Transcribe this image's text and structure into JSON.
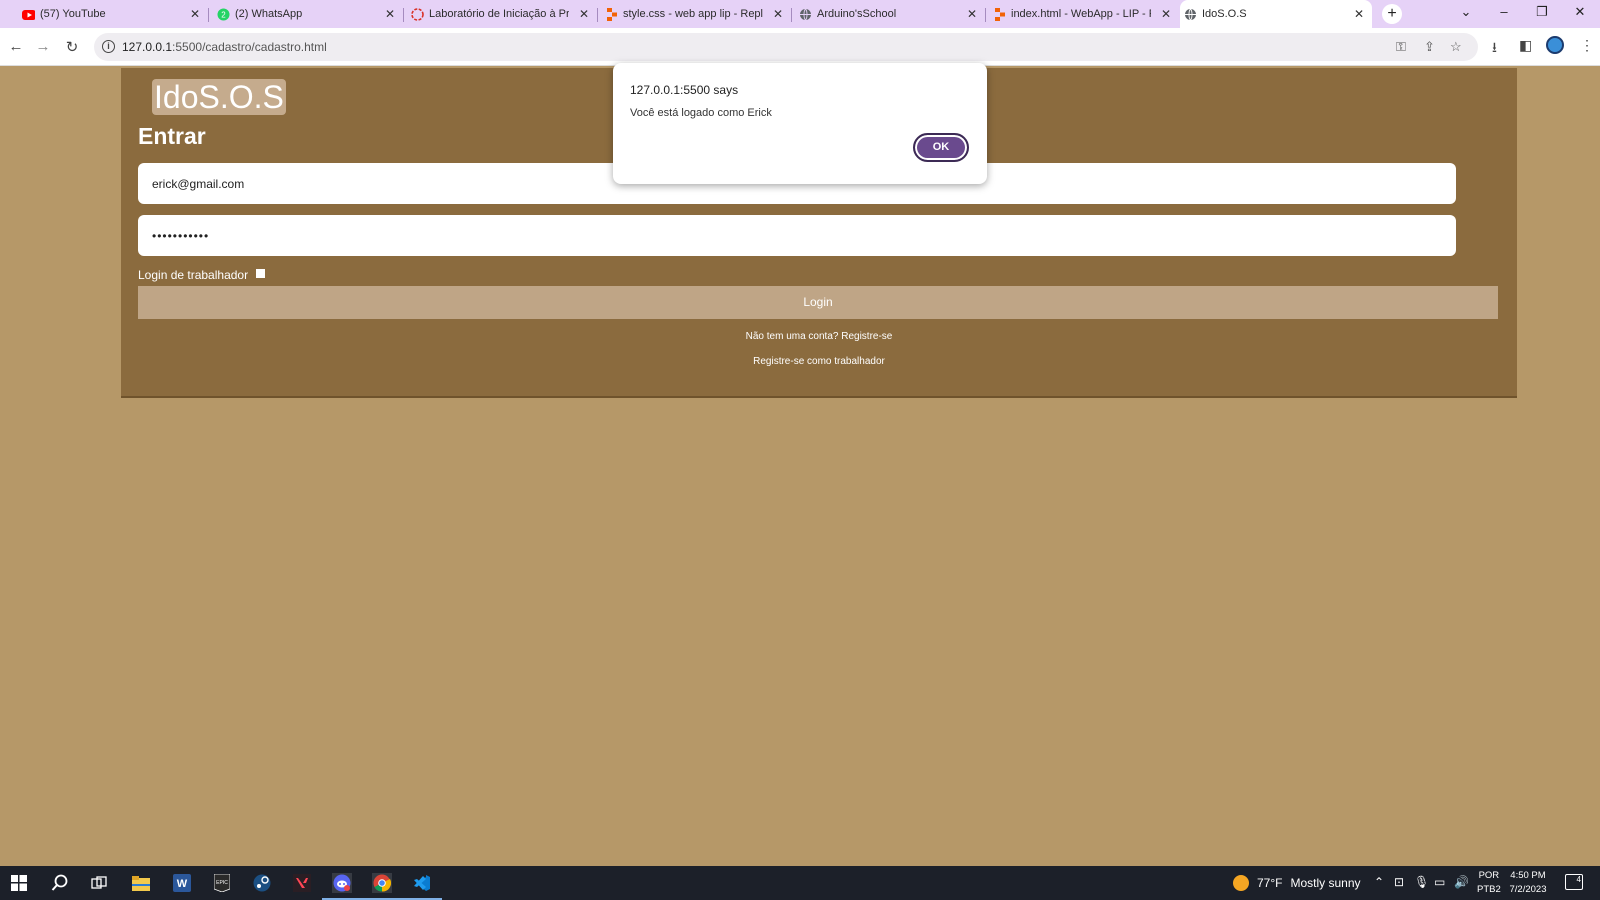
{
  "browser": {
    "tabs": [
      {
        "title": "(57) YouTube",
        "icon": "youtube-icon",
        "icon_color": "#ff0000"
      },
      {
        "title": "(2) WhatsApp",
        "icon": "whatsapp-icon",
        "icon_color": "#25d366"
      },
      {
        "title": "Laboratório de Iniciação à Prog",
        "icon": "lab-icon",
        "icon_color": "#d93025"
      },
      {
        "title": "style.css - web app lip - Replit",
        "icon": "replit-icon",
        "icon_color": "#f26207"
      },
      {
        "title": "Arduino'sSchool",
        "icon": "globe-icon",
        "icon_color": "#5f6368"
      },
      {
        "title": "index.html - WebApp - LIP - Re",
        "icon": "replit-icon",
        "icon_color": "#f26207"
      },
      {
        "title": "IdoS.O.S",
        "icon": "globe-icon",
        "icon_color": "#5f6368"
      }
    ],
    "active_tab": 6,
    "url": "127.0.0.1:5500/cadastro/cadastro.html",
    "url_host": "127.0.0.1",
    "url_rest": ":5500/cadastro/cadastro.html"
  },
  "page": {
    "logo": "IdoS.O.S",
    "heading": "Entrar",
    "email_value": "erick@gmail.com",
    "password_value": "•••••••••••",
    "worker_login_label": "Login de trabalhador",
    "login_button": "Login",
    "register_link": "Não tem uma conta? Registre-se",
    "register_worker_link": "Registre-se como trabalhador"
  },
  "alert": {
    "title": "127.0.0.1:5500 says",
    "message": "Você está logado como Erick",
    "ok_label": "OK"
  },
  "taskbar": {
    "weather_temp": "77°F",
    "weather_text": "Mostly sunny",
    "lang_line1": "POR",
    "lang_line2": "PTB2",
    "time": "4:50 PM",
    "date": "7/2/2023",
    "notifications": "4"
  },
  "colors": {
    "page_bg": "#b69868",
    "card_bg": "#8b6b3e",
    "button_bg": "#bfa586",
    "tab_strip": "#e6d2f7",
    "ok_button": "#6a4a8e"
  }
}
